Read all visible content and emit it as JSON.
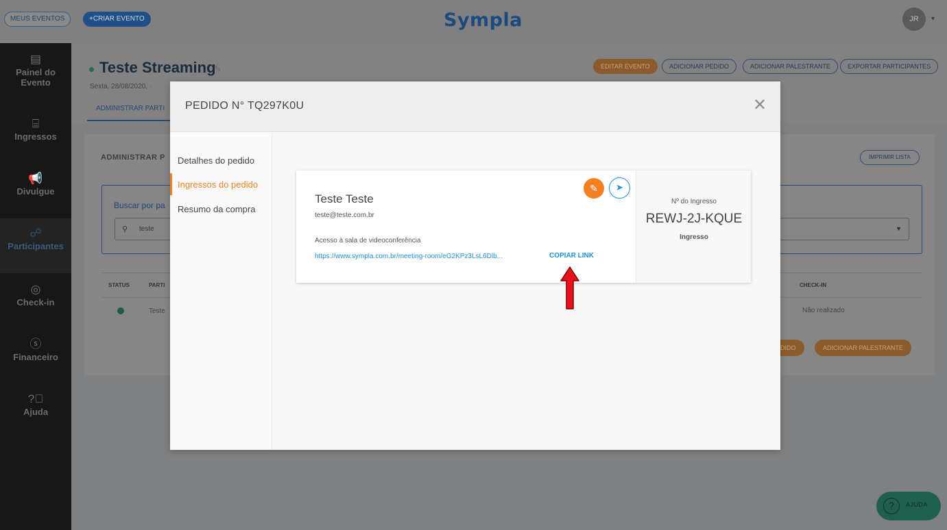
{
  "topbar": {
    "my_events": "MEUS EVENTOS",
    "create_event": "+CRIAR EVENTO",
    "logo": "Sympla",
    "avatar_initials": "JR"
  },
  "sidebar": {
    "items": [
      {
        "label": "Painel do Evento",
        "icon": "dashboard-icon"
      },
      {
        "label": "Ingressos",
        "icon": "ticket-icon"
      },
      {
        "label": "Divulgue",
        "icon": "megaphone-icon"
      },
      {
        "label": "Participantes",
        "icon": "people-icon"
      },
      {
        "label": "Check-in",
        "icon": "check-circle-icon"
      },
      {
        "label": "Financeiro",
        "icon": "dollar-icon"
      },
      {
        "label": "Ajuda",
        "icon": "question-icon"
      }
    ]
  },
  "event": {
    "title": "Teste Streaming",
    "date": "Sexta, 28/08/2020, ·",
    "tab": "ADMINISTRAR PARTI",
    "actions": {
      "edit": "EDITAR EVENTO",
      "add_order": "ADICIONAR PEDIDO",
      "add_speaker": "ADICIONAR PALESTRANTE",
      "export": "EXPORTAR PARTICIPANTES"
    }
  },
  "admin": {
    "section_title": "ADMINISTRAR P",
    "print_list": "IMPRIMIR LISTA",
    "search_label": "Buscar por pa",
    "search_value": "teste",
    "table": {
      "headers": {
        "status": "STATUS",
        "participant": "PARTI",
        "checkin": "CHECK-IN"
      },
      "row": {
        "name": "Teste",
        "checkin": "Não realizado"
      }
    },
    "bottom_buttons": {
      "add_order": "EDIDO",
      "add_speaker": "ADICIONAR PALESTRANTE"
    }
  },
  "help": {
    "label": "AJUDA"
  },
  "modal": {
    "title": "PEDIDO N° TQ297K0U",
    "nav": [
      "Detalhes do pedido",
      "Ingressos do pedido",
      "Resumo da compra"
    ],
    "active_nav": 1,
    "ticket": {
      "name": "Teste Teste",
      "email": "teste@teste.com.br",
      "access_label": "Acesso à sala de videoconferência",
      "link": "https://www.sympla.com.br/meeting-room/eG2KPz3LsL6Dlb...",
      "copy_label": "COPIAR LINK",
      "number_label": "Nº do Ingresso",
      "number": "REWJ-2J-KQUE",
      "type": "Ingresso"
    }
  },
  "colors": {
    "accent_orange": "#f48024",
    "link_blue": "#1f8fd6",
    "brand_navy": "#1a4a7e",
    "annotation_red": "#e8111b"
  }
}
